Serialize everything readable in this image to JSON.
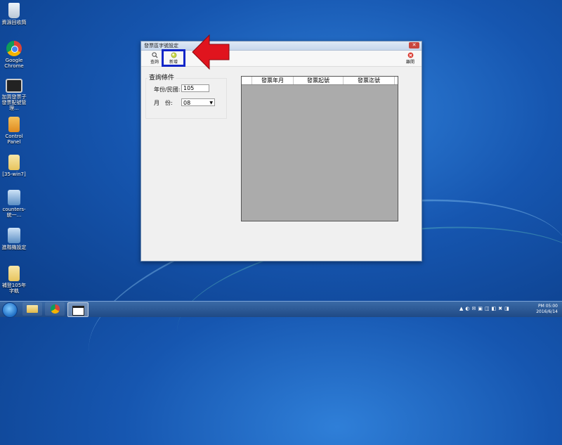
{
  "desktop": {
    "icons": [
      {
        "label": "資源回收筒",
        "icon": "recycle-bin-icon"
      },
      {
        "label": "Google Chrome",
        "icon": "chrome-icon"
      },
      {
        "label": "加買發票子發票配號管理...",
        "icon": "monitor-icon"
      },
      {
        "label": "Control Panel",
        "icon": "control-panel-icon"
      },
      {
        "label": "[35-win7]",
        "icon": "folder-icon"
      },
      {
        "label": "counters-統一...",
        "icon": "app-icon"
      },
      {
        "label": "進階機設定",
        "icon": "app-icon"
      },
      {
        "label": "補登105年字軌",
        "icon": "folder-icon"
      }
    ]
  },
  "window": {
    "title": "發票區字號設定",
    "toolbar": {
      "query_label": "查詢",
      "add_label": "新增",
      "exit_label": "離開"
    },
    "query_panel": {
      "title": "查詢條件",
      "year_label": "年份/民國:",
      "year_value": "105",
      "month_label": "月　份:",
      "month_value": "08"
    },
    "grid": {
      "columns": [
        "",
        "發票年月",
        "發票起號",
        "發票迄號"
      ]
    }
  },
  "taskbar": {
    "time": "PM 05:00",
    "date": "2016/6/14"
  },
  "colors": {
    "highlight_box": "#1226c8",
    "annotation_arrow": "#e0141e",
    "grid_background": "#ababab"
  }
}
